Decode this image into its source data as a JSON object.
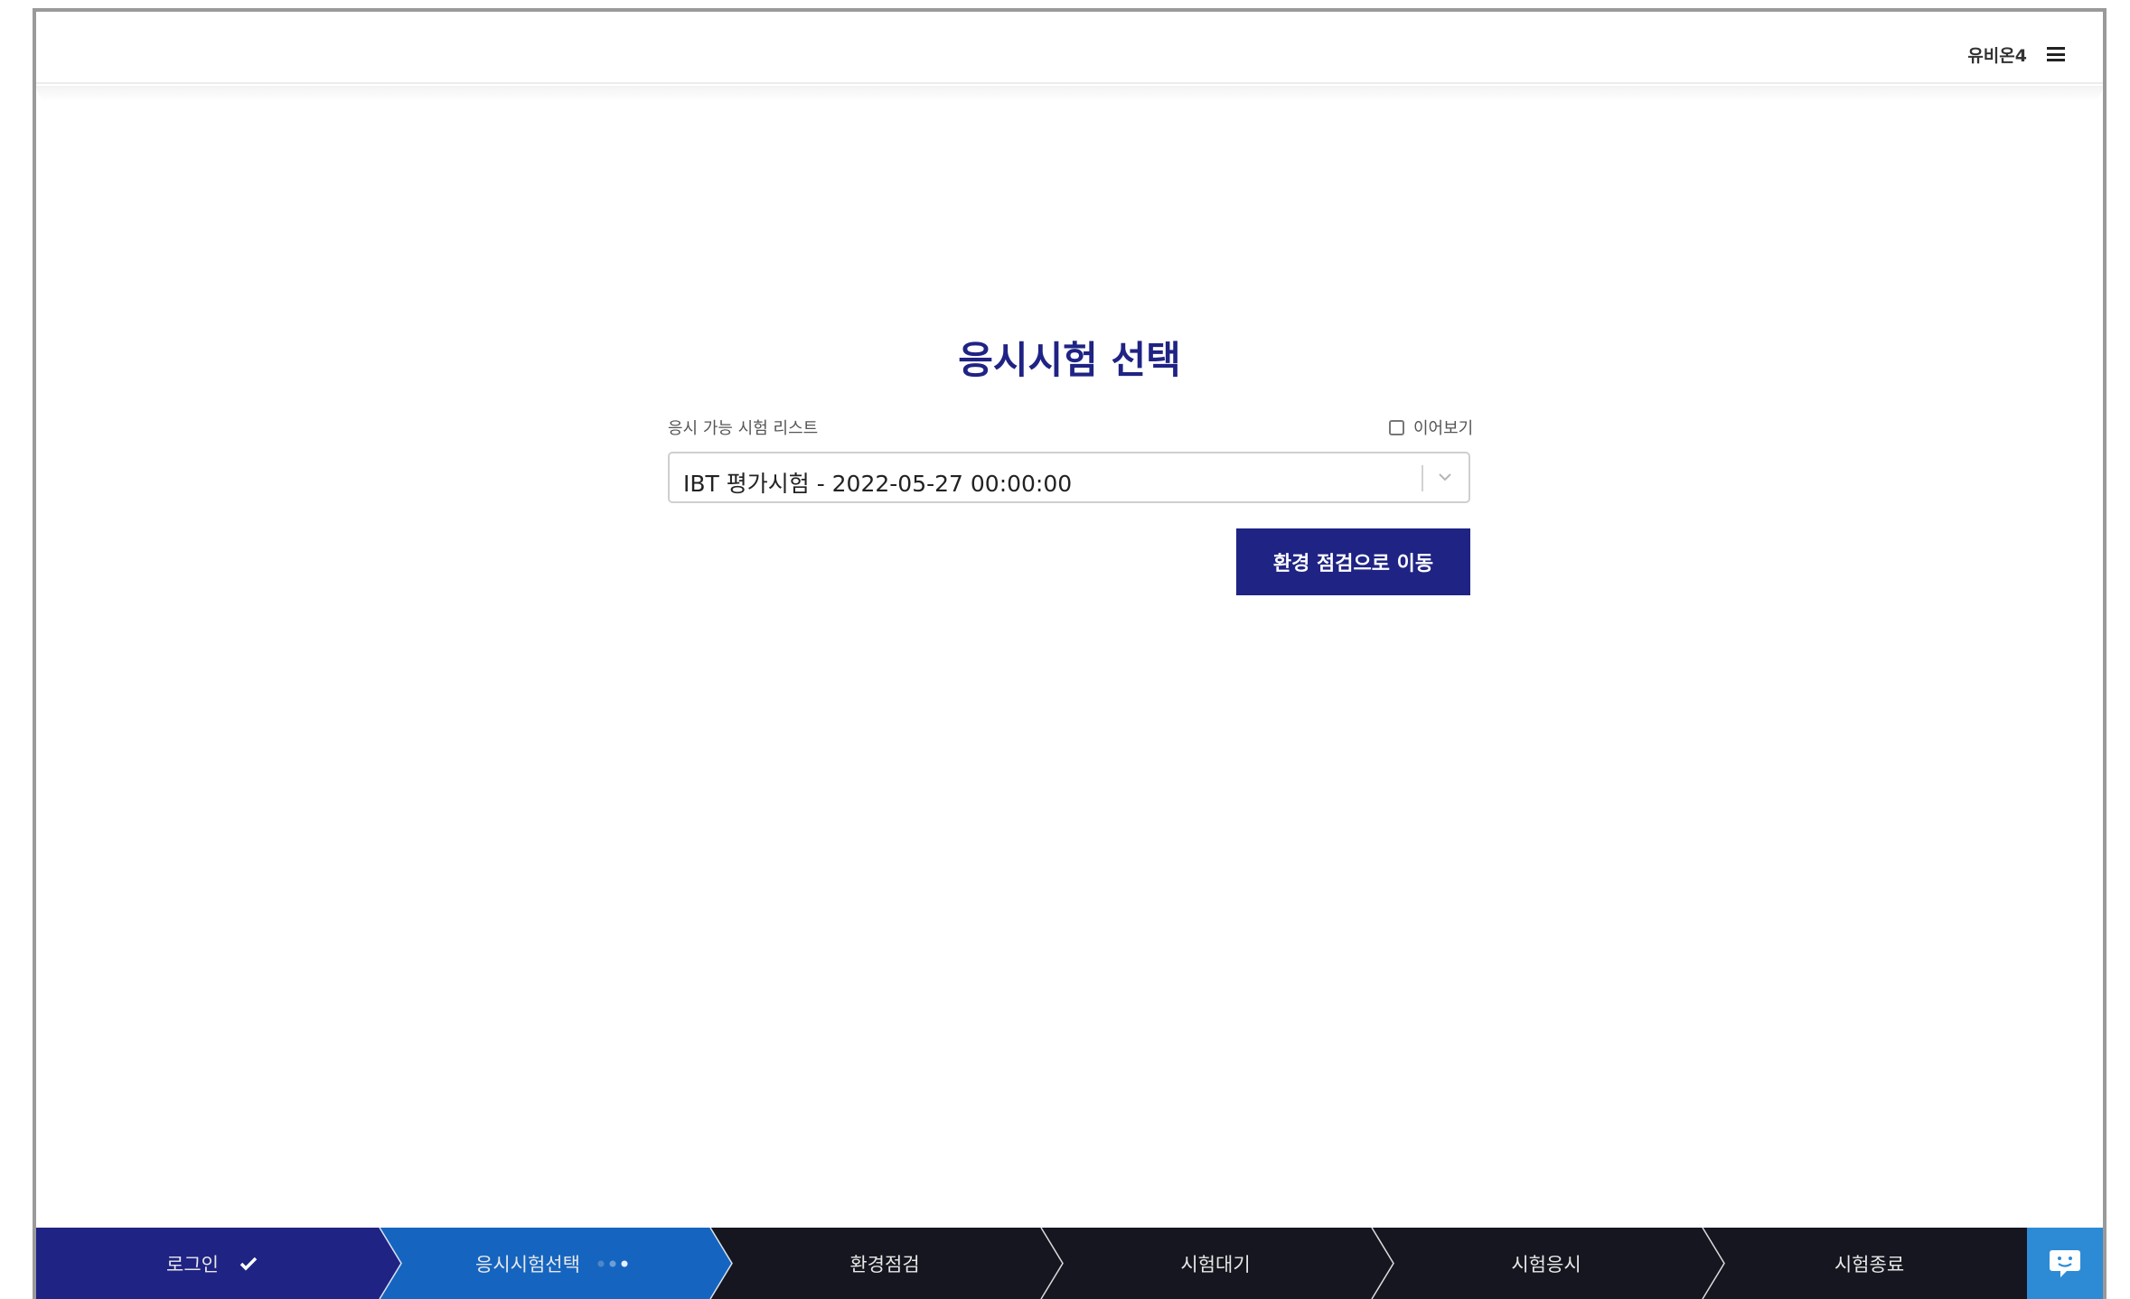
{
  "header": {
    "user_name": "유비온4"
  },
  "main": {
    "title": "응시시험 선택",
    "list_label": "응시 가능 시험 리스트",
    "continue_label": "이어보기",
    "continue_checked": false,
    "selected_exam": "IBT 평가시험 - 2022-05-27 00:00:00",
    "go_button_label": "환경 점검으로 이동"
  },
  "steps": [
    {
      "label": "로그인",
      "state": "done"
    },
    {
      "label": "응시시험선택",
      "state": "current"
    },
    {
      "label": "환경점검",
      "state": "pending"
    },
    {
      "label": "시험대기",
      "state": "pending"
    },
    {
      "label": "시험응시",
      "state": "pending"
    },
    {
      "label": "시험종료",
      "state": "pending"
    }
  ],
  "colors": {
    "primary": "#1f2384",
    "step_done": "#1f2384",
    "step_current": "#1565c0",
    "step_pending": "#15161f",
    "chat": "#2d8bd6"
  },
  "icons": {
    "menu": "hamburger-icon",
    "check": "check-icon",
    "progress": "dots-icon",
    "chevron": "chevron-down-icon",
    "chat": "chat-icon"
  }
}
